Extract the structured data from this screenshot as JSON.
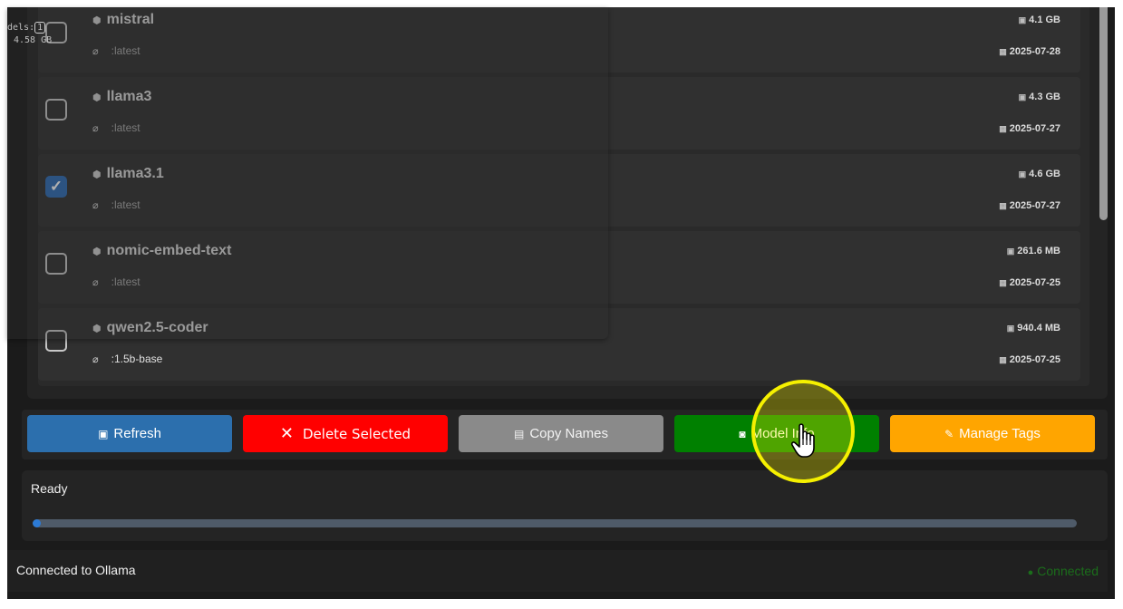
{
  "models": [
    {
      "name": "mistral",
      "tag": ":latest",
      "size": "4.1 GB",
      "date": "2025-07-28",
      "checked": false
    },
    {
      "name": "llama3",
      "tag": ":latest",
      "size": "4.3 GB",
      "date": "2025-07-27",
      "checked": false
    },
    {
      "name": "llama3.1",
      "tag": ":latest",
      "size": "4.6 GB",
      "date": "2025-07-27",
      "checked": true
    },
    {
      "name": "nomic-embed-text",
      "tag": ":latest",
      "size": "261.6 MB",
      "date": "2025-07-25",
      "checked": false
    },
    {
      "name": "qwen2.5-coder",
      "tag": ":1.5b-base",
      "size": "940.4 MB",
      "date": "2025-07-25",
      "checked": false
    }
  ],
  "popup": {
    "label_prefix": "dels:",
    "count": "1",
    "size": "4.58 GB"
  },
  "buttons": {
    "refresh": "Refresh",
    "delete_selected": "Delete Selected",
    "copy_names": "Copy Names",
    "model_info": "Model Info",
    "manage_tags": "Manage Tags"
  },
  "status": {
    "text": "Ready",
    "progress_fraction": 0.008
  },
  "footer": {
    "left": "Connected to Ollama",
    "right": "Connected"
  },
  "icons": {
    "model": "cube-icon",
    "tag": "tag-icon",
    "size": "disk-icon",
    "date": "calendar-icon",
    "refresh": "refresh-icon",
    "delete": "x-icon",
    "copy": "clipboard-icon",
    "info": "info-icon",
    "tags": "tag-icon",
    "cursor": "hand-pointer-icon"
  },
  "colors": {
    "refresh": "#2c6fad",
    "delete": "#ff0000",
    "copy": "#8a8a8a",
    "info": "#008000",
    "tags": "#ffa500",
    "connected": "#1b6e1b",
    "checkbox_checked": "#2c6bb5",
    "highlight": "#f5f000"
  }
}
